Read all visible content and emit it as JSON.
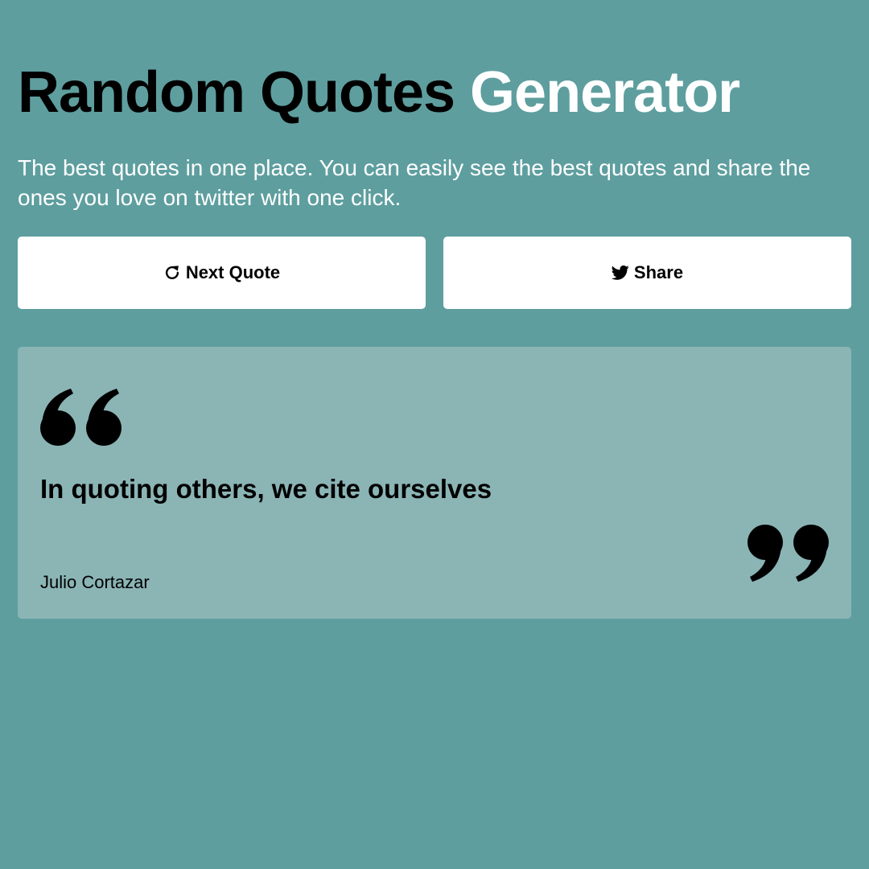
{
  "header": {
    "title_main": "Random Quotes",
    "title_accent": "Generator",
    "subtitle": "The best quotes in one place. You can easily see the best quotes and share the ones you love on twitter with one click."
  },
  "actions": {
    "next_label": "Next Quote",
    "next_icon": "refresh-icon",
    "share_label": "Share",
    "share_icon": "twitter-icon"
  },
  "quote": {
    "text": "In quoting others, we cite ourselves",
    "author": "Julio Cortazar",
    "open_icon": "open-quote-icon",
    "close_icon": "close-quote-icon"
  },
  "colors": {
    "background": "#5e9e9f",
    "card": "#8bb4b5",
    "accent_text": "#ffffff",
    "button": "#ffffff"
  }
}
